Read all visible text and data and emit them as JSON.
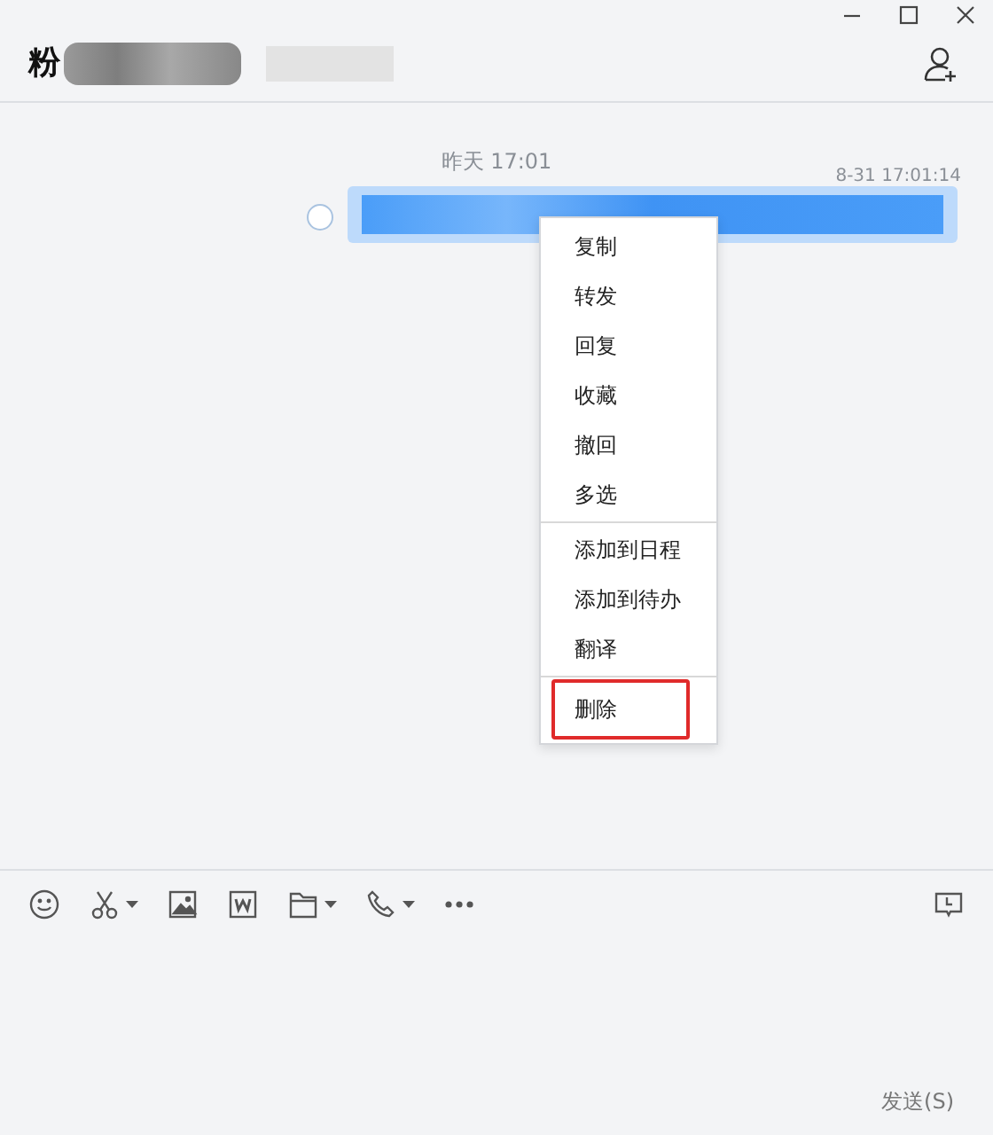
{
  "window": {
    "controls": [
      {
        "kind": "minimize"
      },
      {
        "kind": "maximize"
      },
      {
        "kind": "close"
      }
    ]
  },
  "header": {
    "title": "粉"
  },
  "messages": [
    {
      "date_divider": "昨天 17:01",
      "time": "8-31 17:01:14",
      "selected": false
    }
  ],
  "context_menu": {
    "groups": [
      [
        {
          "label": "复制",
          "highlighted": false
        },
        {
          "label": "转发",
          "highlighted": false
        },
        {
          "label": "回复",
          "highlighted": false
        },
        {
          "label": "收藏",
          "highlighted": false
        },
        {
          "label": "撤回",
          "highlighted": false
        },
        {
          "label": "多选",
          "highlighted": false
        }
      ],
      [
        {
          "label": "添加到日程",
          "highlighted": false
        },
        {
          "label": "添加到待办",
          "highlighted": false
        },
        {
          "label": "翻译",
          "highlighted": false
        }
      ],
      [
        {
          "label": "删除",
          "highlighted": true
        }
      ]
    ]
  },
  "toolbar": [
    {
      "kind": "emoji",
      "dropdown": false
    },
    {
      "kind": "scissors",
      "dropdown": true
    },
    {
      "kind": "image",
      "dropdown": false
    },
    {
      "kind": "word",
      "dropdown": false
    },
    {
      "kind": "folder",
      "dropdown": true
    },
    {
      "kind": "phone",
      "dropdown": true
    },
    {
      "kind": "more",
      "dropdown": false
    }
  ],
  "send_button": "发送(S)"
}
